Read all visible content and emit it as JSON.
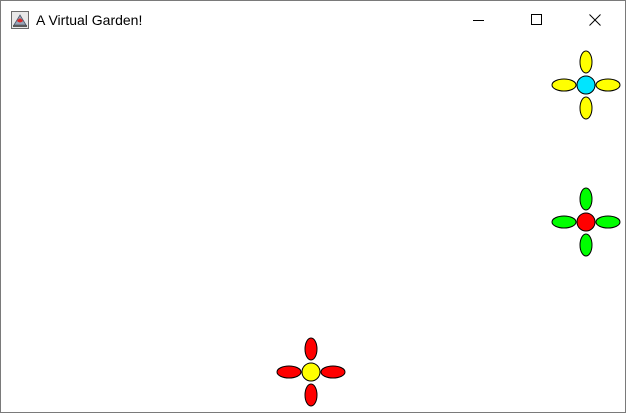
{
  "window": {
    "title": "A Virtual Garden!",
    "app_icon": "java-app-icon",
    "controls": [
      {
        "name": "minimize",
        "icon": "minimize-icon"
      },
      {
        "name": "maximize",
        "icon": "maximize-icon"
      },
      {
        "name": "close",
        "icon": "close-icon"
      }
    ]
  },
  "garden": {
    "flowers": [
      {
        "id": "flower-1",
        "petal_color": "#ffff00",
        "center_color": "#00e5ff"
      },
      {
        "id": "flower-2",
        "petal_color": "#00ff00",
        "center_color": "#ff0000"
      },
      {
        "id": "flower-3",
        "petal_color": "#ff0000",
        "center_color": "#ffff00"
      }
    ]
  }
}
